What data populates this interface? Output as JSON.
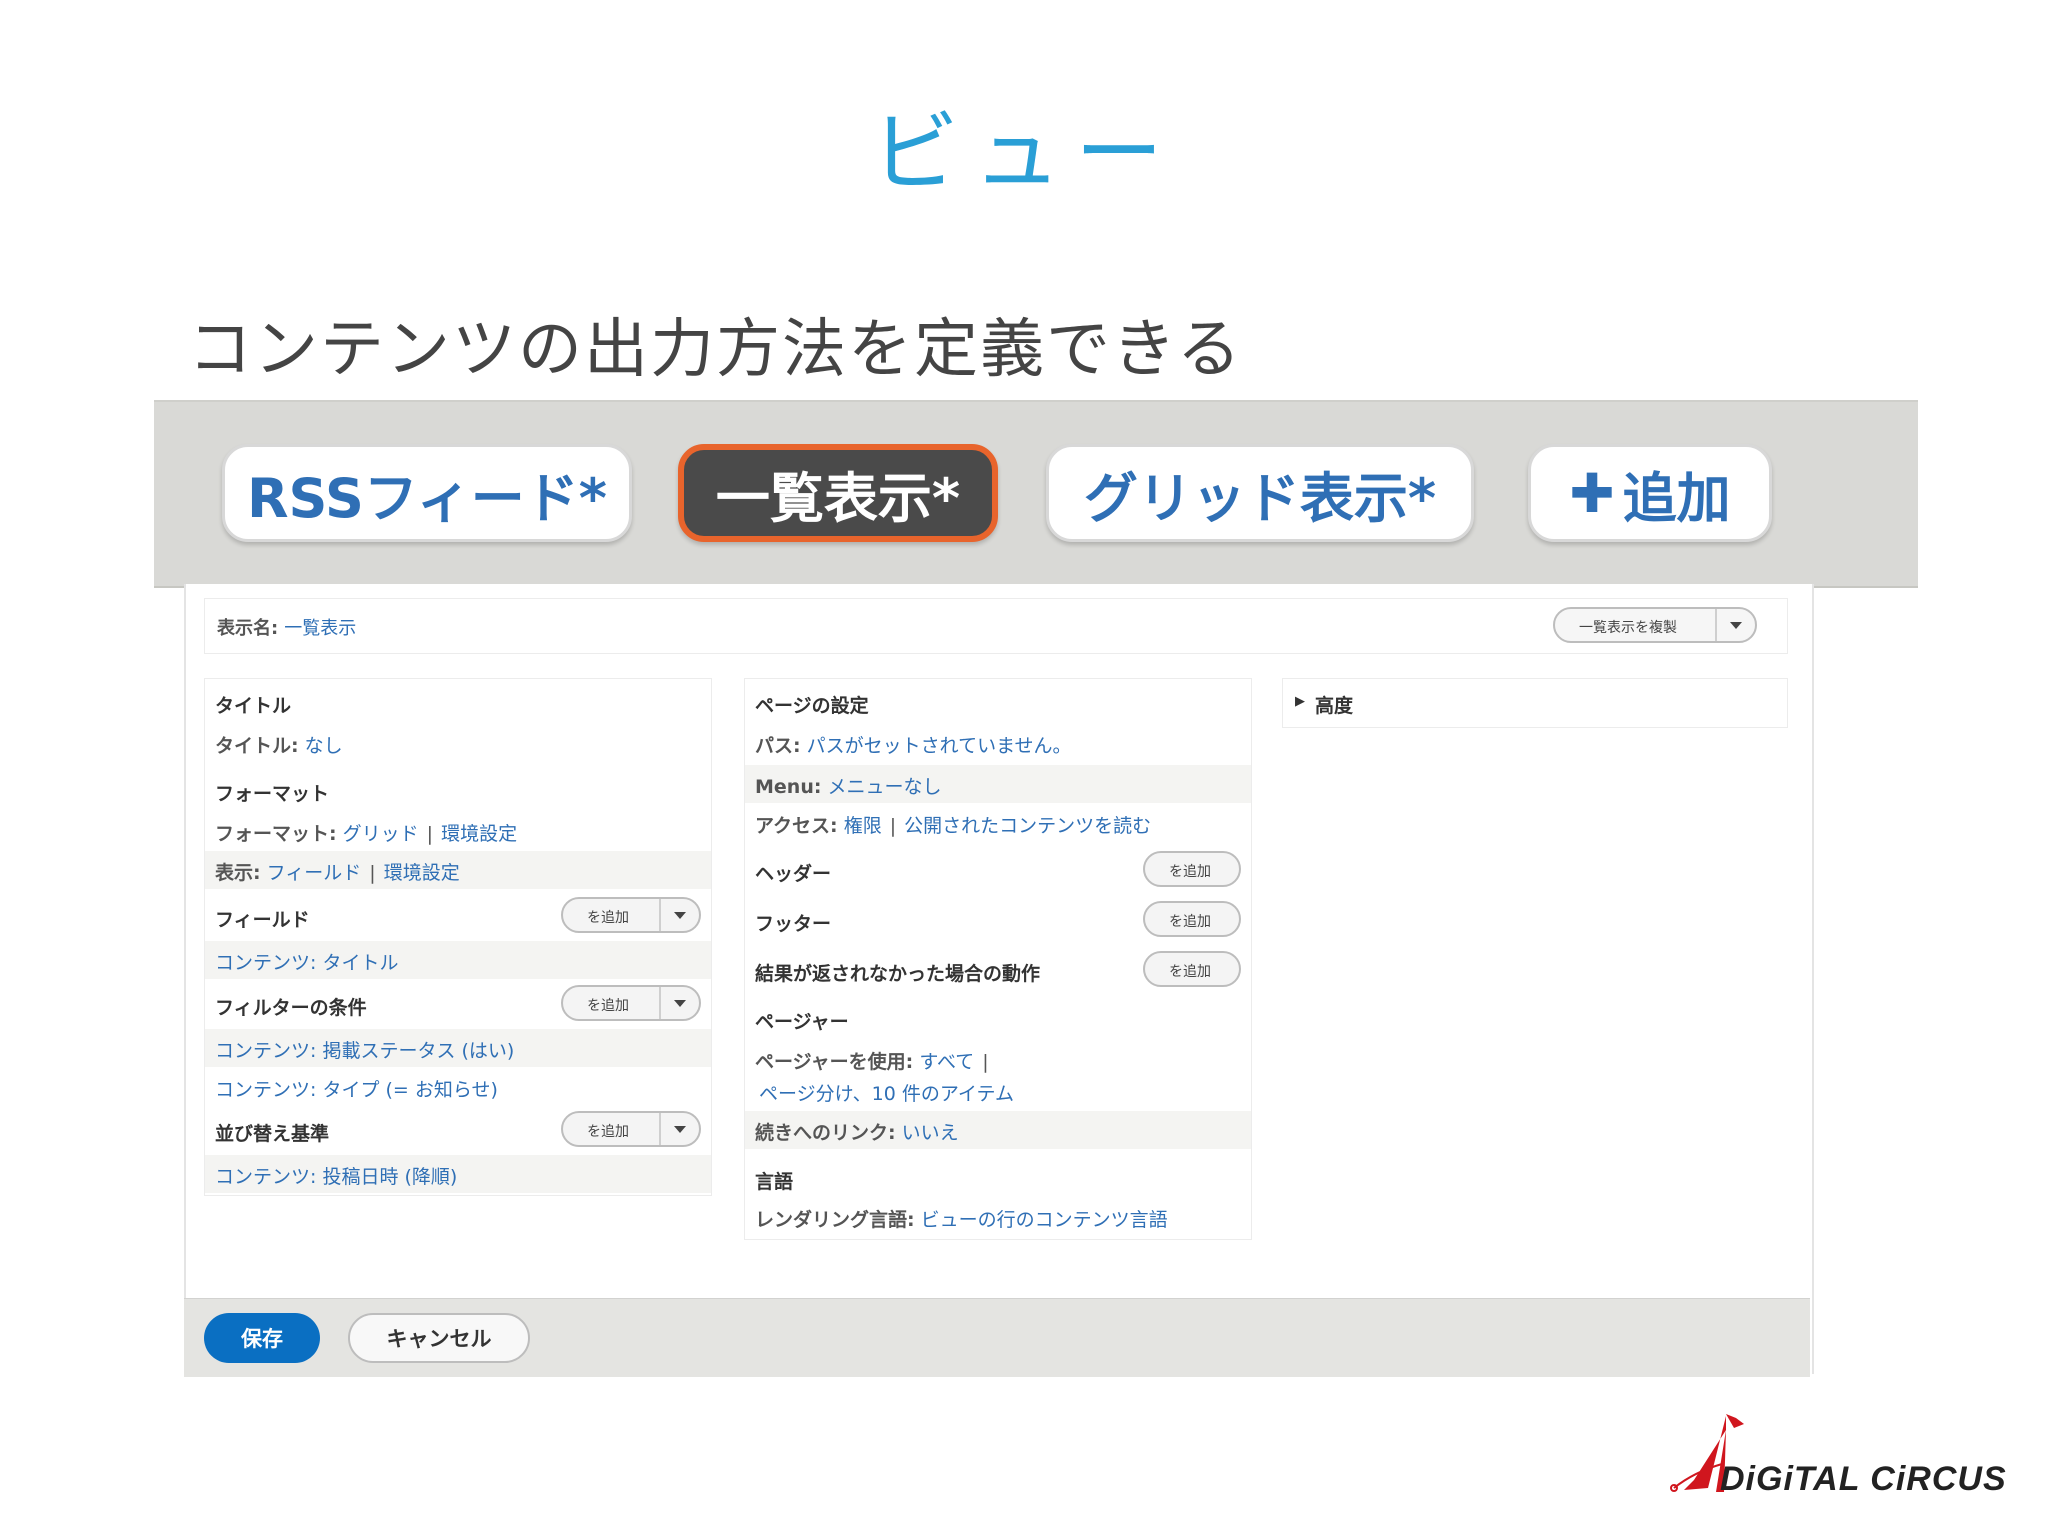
{
  "slide": {
    "title": "ビュー",
    "subtitle": "コンテンツの出力方法を定義できる"
  },
  "tabs": [
    {
      "label": "RSSフィード*"
    },
    {
      "label": "一覧表示*",
      "active": true
    },
    {
      "label": "グリッド表示*"
    },
    {
      "label": "追加"
    }
  ],
  "display_name": {
    "label": "表示名:",
    "value": "一覧表示",
    "duplicate_button": "一覧表示を複製"
  },
  "left_column": {
    "title_section": {
      "heading": "タイトル",
      "label": "タイトル:",
      "value": "なし"
    },
    "format_section": {
      "heading": "フォーマット",
      "format_label": "フォーマット:",
      "format_value": "グリッド",
      "format_settings": "環境設定",
      "show_label": "表示:",
      "show_value": "フィールド",
      "show_settings": "環境設定"
    },
    "fields_section": {
      "heading": "フィールド",
      "add_label": "を追加",
      "items": [
        "コンテンツ: タイトル"
      ]
    },
    "filters_section": {
      "heading": "フィルターの条件",
      "add_label": "を追加",
      "items": [
        "コンテンツ: 掲載ステータス (はい)",
        "コンテンツ: タイプ (= お知らせ)"
      ]
    },
    "sort_section": {
      "heading": "並び替え基準",
      "add_label": "を追加",
      "items": [
        "コンテンツ: 投稿日時 (降順)"
      ]
    }
  },
  "middle_column": {
    "page_settings": {
      "heading": "ページの設定",
      "path_label": "パス:",
      "path_value": "パスがセットされていません。",
      "menu_label": "Menu:",
      "menu_value": "メニューなし",
      "access_label": "アクセス:",
      "access_value1": "権限",
      "access_value2": "公開されたコンテンツを読む"
    },
    "header": {
      "heading": "ヘッダー",
      "add_label": "を追加"
    },
    "footer": {
      "heading": "フッター",
      "add_label": "を追加"
    },
    "no_results": {
      "heading": "結果が返されなかった場合の動作",
      "add_label": "を追加"
    },
    "pager": {
      "heading": "ページャー",
      "use_label": "ページャーを使用:",
      "use_value": "すべて",
      "detail_value": "ページ分け、10 件のアイテム",
      "more_label": "続きへのリンク:",
      "more_value": "いいえ"
    },
    "language": {
      "heading": "言語",
      "render_label": "レンダリング言語:",
      "render_value": "ビューの行のコンテンツ言語"
    }
  },
  "right_column": {
    "advanced": "高度"
  },
  "actions": {
    "save": "保存",
    "cancel": "キャンセル"
  },
  "logo": {
    "text": "DiGiTAL CiRCUS"
  },
  "colors": {
    "accent": "#2a9fd6",
    "link": "#2f6fb5",
    "active_tab_border": "#e8642c",
    "save": "#0a6fc2",
    "logo_red": "#d0161e"
  }
}
